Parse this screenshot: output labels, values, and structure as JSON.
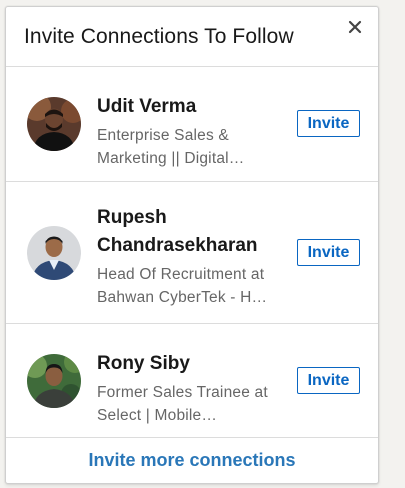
{
  "header": {
    "title": "Invite Connections To Follow",
    "close_icon": "close-icon",
    "close_glyph": "×"
  },
  "connections": [
    {
      "name_lines": [
        "Udit Verma"
      ],
      "desc_lines": [
        "Enterprise Sales &",
        "Marketing || Digital…"
      ],
      "invite_label": "Invite",
      "avatar_icon": "person-avatar"
    },
    {
      "name_lines": [
        "Rupesh",
        "Chandrasekharan"
      ],
      "desc_lines": [
        "Head Of Recruitment at",
        "Bahwan CyberTek - H…"
      ],
      "invite_label": "Invite",
      "avatar_icon": "person-avatar"
    },
    {
      "name_lines": [
        "Rony Siby"
      ],
      "desc_lines": [
        "Former Sales Trainee at",
        "Select | Mobile…"
      ],
      "invite_label": "Invite",
      "avatar_icon": "person-avatar"
    }
  ],
  "footer": {
    "link_label": "Invite more connections"
  },
  "colors": {
    "accent": "#0a66c2",
    "link": "#2a77b8"
  }
}
